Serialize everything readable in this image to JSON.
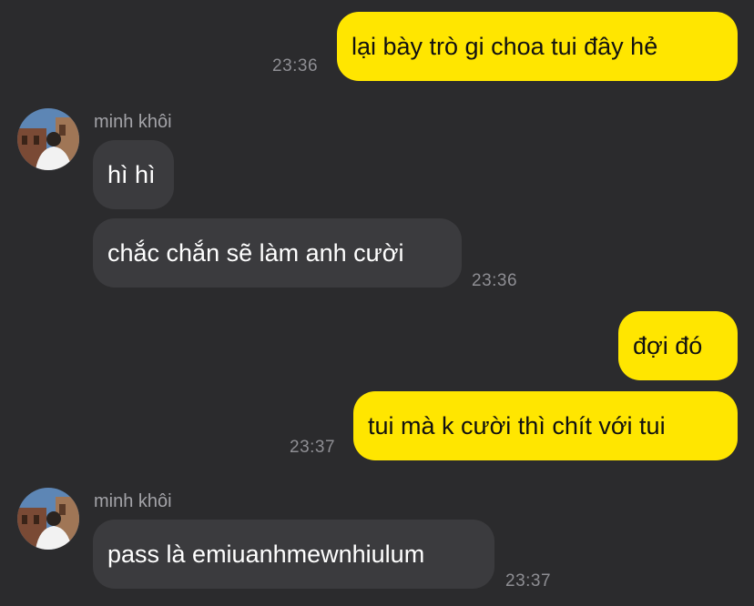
{
  "conversation": {
    "messages": [
      {
        "direction": "outgoing",
        "text": "lại bày trò gi choa tui đây hẻ",
        "time": "23:36"
      },
      {
        "direction": "incoming",
        "sender": "minh khôi",
        "text": "hì hì"
      },
      {
        "direction": "incoming",
        "text": "chắc chắn sẽ làm anh cười",
        "time": "23:36"
      },
      {
        "direction": "outgoing",
        "text": "đợi đó"
      },
      {
        "direction": "outgoing",
        "text": "tui mà k cười thì chít với tui",
        "time": "23:37"
      },
      {
        "direction": "incoming",
        "sender": "minh khôi",
        "text": "pass là emiuanhmewnhiulum",
        "time": "23:37"
      }
    ]
  },
  "colors": {
    "background": "#2b2b2d",
    "outgoing_bubble": "#ffe600",
    "incoming_bubble": "#3b3b3e",
    "timestamp": "#8e8e93"
  },
  "icons": {
    "avatar": "profile-photo"
  }
}
